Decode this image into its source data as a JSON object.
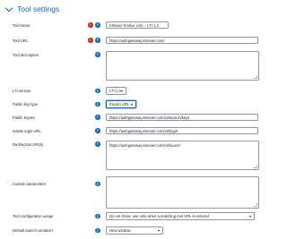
{
  "section": {
    "title": "Tool settings"
  },
  "fields": {
    "tool_name": {
      "label": "Tool name",
      "value": "Elsevier Evolve Link – LTI 1.3"
    },
    "tool_url": {
      "label": "Tool URL",
      "value": "https://authgateway.elsevier.com/"
    },
    "tool_description": {
      "label": "Tool description",
      "value": ""
    },
    "lti_version": {
      "label": "LTI version",
      "value": "LTI 1.3"
    },
    "public_key_type": {
      "label": "Public key type",
      "value": "Keyset URL"
    },
    "public_keyset": {
      "label": "Public keyset",
      "value": "https://authgateway.elsevier.com/v2/launch/keys"
    },
    "initiate_login_url": {
      "label": "Initiate login URL",
      "value": "https://authgateway.elsevier.com/v2/login"
    },
    "redirection_uris": {
      "label": "Redirection URI(s)",
      "value": "https://authgateway.elsevier.com/v2/launch"
    },
    "custom_parameters": {
      "label": "Custom parameters",
      "value": ""
    },
    "tool_configuration_usage": {
      "label": "Tool configuration usage",
      "value": "Do not show; use only when a matching tool URL is entered"
    },
    "default_launch_container": {
      "label": "Default launch container",
      "value": "New window"
    }
  },
  "colors": {
    "link": "#0f6cbf",
    "required": "#ca3120",
    "help": "#0f6cbf",
    "border": "#8f959e"
  },
  "icons": {
    "section_toggle": "chevron-down-icon",
    "required": "required-icon",
    "help": "help-icon"
  }
}
